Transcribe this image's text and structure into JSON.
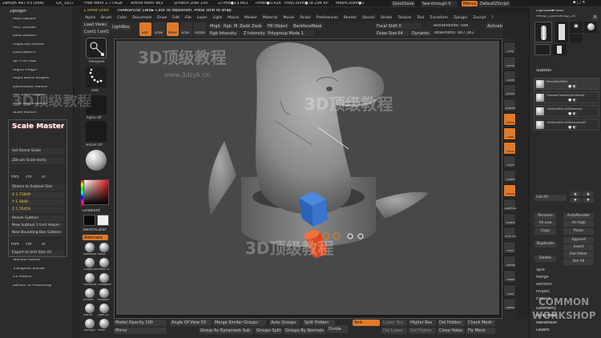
{
  "title_bar": {
    "app": "ZBrush 4R7 P3 (x64)",
    "qs": "QS_1827",
    "free_mem": "Free Mem 2.774GB",
    "active_mem": "Active Mem 983",
    "scratch": "Scratch Disk 150",
    "ztime": "ZTime●13.663",
    "timer": "Timer●0.426",
    "polycount": "PolyCount●78.294 KP",
    "meshcount": "MeshCount●2",
    "quicksave": "QuickSave",
    "see_through": "See-through  0",
    "menus": "Menus",
    "default_script": "DefaultZScript"
  },
  "message_bar": {
    "count": "1.5848 Units",
    "transpose": "TRANSPOSE LINE► Click to reposition. Press Shift to snap."
  },
  "main_menu": [
    "Alpha",
    "Brush",
    "Color",
    "Document",
    "Draw",
    "Edit",
    "File",
    "Layer",
    "Light",
    "Macro",
    "Marker",
    "Material",
    "Movie",
    "Picker",
    "Preferences",
    "Render",
    "Stencil",
    "Stroke",
    "Texture",
    "Tool",
    "Transform",
    "Zplugin",
    "Zscript",
    "?"
  ],
  "zplugin": {
    "header": "Zplugin",
    "items": [
      "Auto Update",
      "Misc Utilities",
      "Deactivation",
      "Projection Master",
      "QuickSketch",
      "3D Print Hub",
      "Adjust Plugin",
      "Maya Blend Shapes",
      "Decimation Master",
      "FBX ExportImport",
      "Multi Map Exporter",
      "Scale Master"
    ],
    "scale_master": {
      "title": "Scale Master",
      "set_scene_scale": "Set Scene Scale",
      "unify": "ZBrush Scale Unify",
      "units": [
        "mm",
        "cm",
        "in"
      ],
      "slider_label": "Sliders to Subtool Size",
      "x": "X 1.73849",
      "y": "Y 1.5848",
      "z": "Z 1.76459",
      "resize": "Resize Subtool",
      "new_subtool_unit": "New Subtool 1 Unit Helper",
      "new_bounding": "New Bounding Box Subtool",
      "units2": [
        "mm",
        "cm",
        "in"
      ],
      "export": "Export to Unit Size All"
    },
    "items2": [
      "SubTool Master",
      "Transpose Master",
      "UV Master",
      "ZBrush To Photoshop"
    ]
  },
  "left_shelf": {
    "load_views": "Load Views",
    "lightbox": "LightBox",
    "quick_save": "Quick Save",
    "cont_conf": "Cont1 Conf1",
    "edit": "Edit",
    "draw": "Draw",
    "move": "Move",
    "scale": "Scale",
    "rotate": "Rotate",
    "transpose_label": "Transpose",
    "dots_label": "Dots",
    "alpha_off": "Alpha Off",
    "texture_off": "Texture Off",
    "gradient": "Gradient",
    "switch_color": "SwitchColor",
    "alternate": "Alternate",
    "brushes": [
      "Standard",
      "Move",
      "ClayBuildup",
      "Move To",
      "FormSoft",
      "ZModeler",
      "hPolish",
      "Smooth",
      "Planar",
      "Dam_St",
      "TrimDyn",
      "Pinch"
    ]
  },
  "toolbar_top": {
    "mrgb": "Mrgb",
    "rgb": "Rgb",
    "m": "M",
    "zadd": "Zadd",
    "zsub": "Zsub",
    "zcut": "Zcut",
    "focal": "Focal Shift 0",
    "draw_size": "Draw Size 64",
    "rgb_intensity": "Rgb Intensity",
    "z_intensity": "Z Intensity 25",
    "fill_object": "Fill Object",
    "backface": "BackfaceMask",
    "polygroup": "Polygroup Mode 1",
    "active_points": "ActivePoints: 588",
    "total_points": "TotalPoints: 887,381",
    "dynamic": "Dynamic",
    "activate_symmetry": "Activate Symmetry"
  },
  "right_shelf": [
    "SPix",
    "Scroll",
    "Zoom",
    "Actual",
    "AAHalf",
    "Persp",
    "Floor",
    "Local",
    "LSym",
    "Frame",
    "Move",
    "Zoom3D",
    "Rotate",
    "Line Fill",
    "Polyf",
    "Transp",
    "Ghost",
    "Solo",
    "Xpose"
  ],
  "tool_panel": {
    "header": "Lightbox►Tools",
    "current": "PM3D_Cylinder3D_50",
    "r_label": "R",
    "thumbs": [
      "PM3D_Cylinder3D",
      "PolyMesh3D",
      "SimpleBrush",
      "Sphere3D_Scissors"
    ],
    "subtool_header": "Subtool",
    "subtools": [
      "FormSkullHall",
      "ConvexCowlAnyfo3AxisD",
      "OAStyleSlit-4VDiamond",
      "OAStyleSlit-4VDiamondXP"
    ],
    "list_all": "List All",
    "rename": "Rename",
    "auto_reorder": "AutoReorder",
    "all_low": "All Low",
    "all_high": "All High",
    "copy": "Copy",
    "paste": "Paste",
    "duplicate": "Duplicate",
    "append": "Append",
    "insert": "Insert",
    "delete": "Delete",
    "del_other": "Del Other",
    "del_all": "Del All",
    "split": "Split",
    "merge": "Merge",
    "remesh": "Remesh",
    "project": "Project",
    "extract": "Extract",
    "geometry": "Geometry",
    "arraymesh": "ArrayMesh",
    "nanomesh": "NanoMesh",
    "layers": "Layers"
  },
  "bottom_bar": {
    "model_opacity": "Model Opacity 100",
    "angle_of_view": "Angle Of View 50",
    "merge_similar": "Merge Similar Groups",
    "auto_groups": "Auto Groups",
    "split_hidden": "Split Hidden",
    "mirror": "Mirror",
    "group_as_dynamesh": "Group As Dynamesh Sub",
    "groups_split": "Groups Split",
    "groups_by_normals": "Groups By Normals",
    "divide": "Divide",
    "smt": "Smt",
    "lower_res": "Lower Res",
    "higher_res": "Higher Res",
    "del_lower": "Del Lower",
    "del_higher": "Del Higher",
    "del_hidden": "Del Hidden",
    "close_holes": "Close Holes",
    "check_mesh": "Check Mesh",
    "fix_mesh": "Fix Mesh"
  },
  "watermarks": {
    "cn": "3D顶级教程",
    "url": "www.3dzyk.cn",
    "brand1": "COMMON",
    "brand2": "WORKSHOP"
  },
  "colors": {
    "accent": "#e07a2a",
    "canvas": "#484848",
    "bg": "#262626"
  }
}
